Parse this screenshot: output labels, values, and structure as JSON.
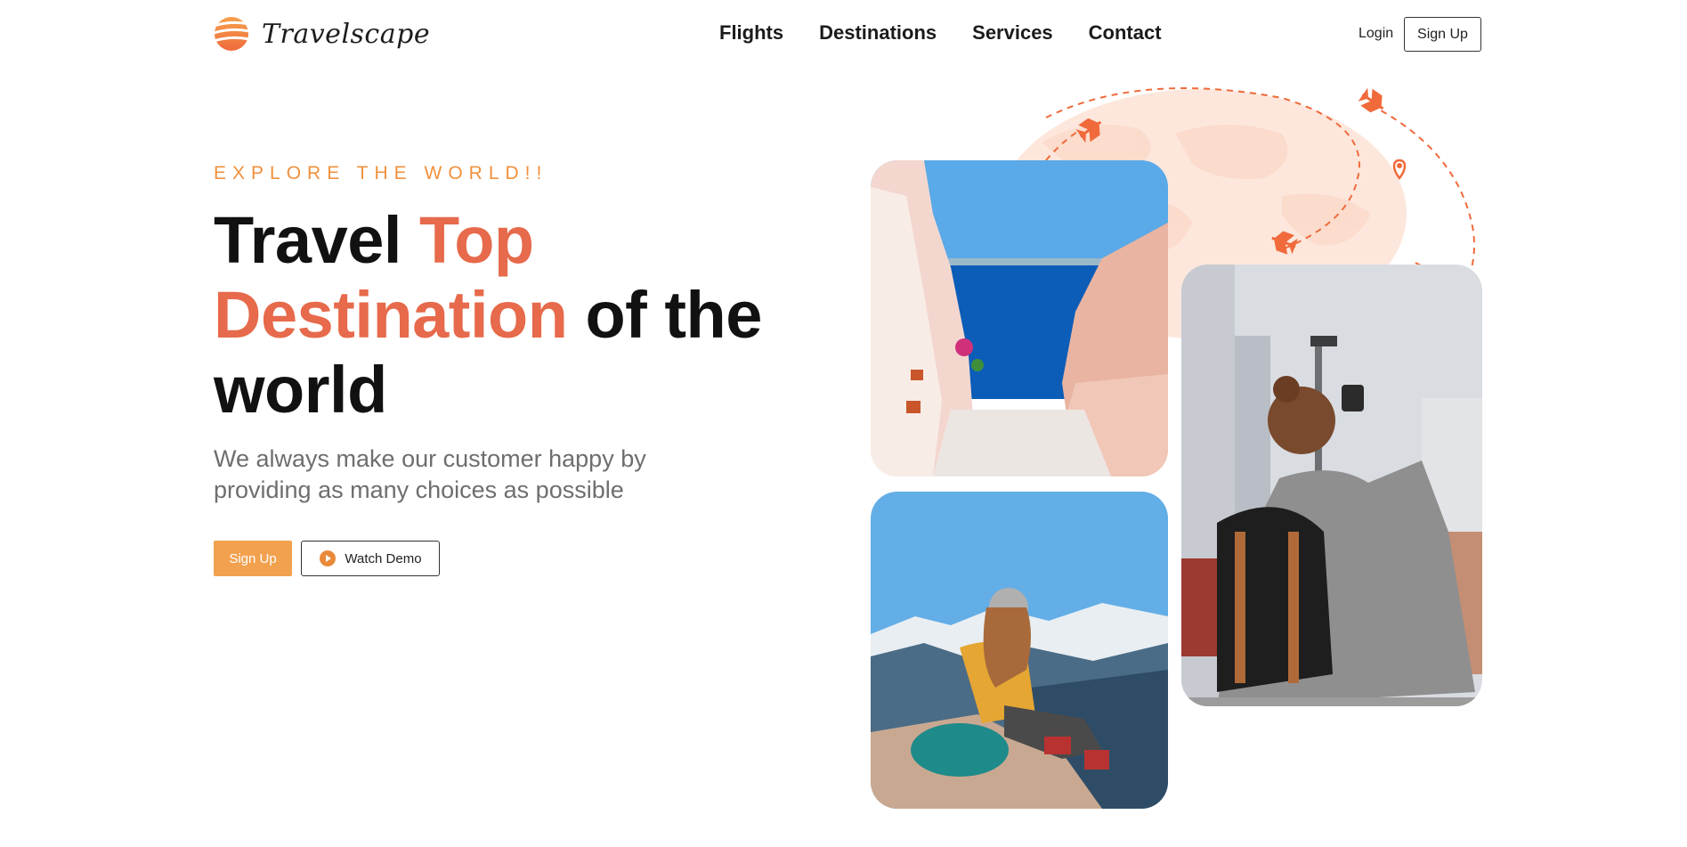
{
  "brand": {
    "name": "Travelscape"
  },
  "nav": {
    "items": [
      {
        "label": "Flights"
      },
      {
        "label": "Destinations"
      },
      {
        "label": "Services"
      },
      {
        "label": "Contact"
      }
    ],
    "login_label": "Login",
    "signup_label": "Sign Up"
  },
  "hero": {
    "eyebrow": "EXPLORE THE WORLD!!",
    "headline": {
      "part1": "Travel ",
      "accent1": "Top",
      "accent2": "Destination",
      "part2": " of the",
      "part3": "world"
    },
    "subtitle": "We always make our customer happy by providing as many choices as possible",
    "cta_primary": "Sign Up",
    "cta_secondary": "Watch Demo"
  },
  "colors": {
    "accent_orange": "#f2a14f",
    "headline_accent": "#e66a4b",
    "eyebrow": "#f0913e",
    "plane": "#f06a3b"
  },
  "icons": [
    "logo-mark-icon",
    "play-icon",
    "plane-icon",
    "location-pin-icon",
    "world-map-icon"
  ]
}
